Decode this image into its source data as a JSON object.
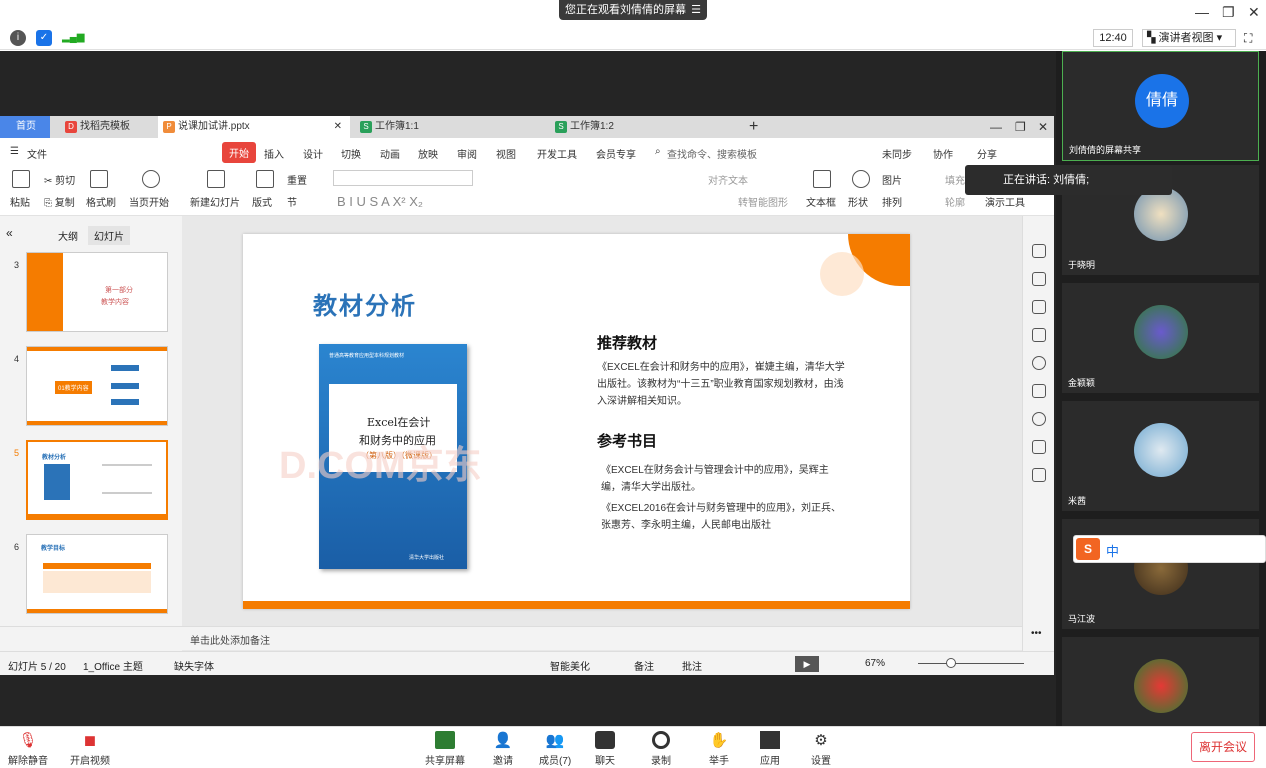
{
  "banner": {
    "text": "您正在观看刘倩倩的屏幕",
    "menu_icon": "menu-icon"
  },
  "status": {
    "time": "12:40",
    "view_label": "演讲者视图"
  },
  "wps": {
    "tabs": [
      "首页",
      "找稻壳模板",
      "说课加试讲.pptx",
      "工作簿1:1",
      "工作簿1:2"
    ],
    "menu": [
      "文件",
      "开始",
      "插入",
      "设计",
      "切换",
      "动画",
      "放映",
      "审阅",
      "视图",
      "开发工具",
      "会员专享"
    ],
    "search_placeholder": "查找命令、搜索模板",
    "right_menu": [
      "未同步",
      "协作",
      "分享"
    ],
    "ribbon": {
      "paste": "粘贴",
      "cut": "剪切",
      "copy": "复制",
      "format_painter": "格式刷",
      "start_from_current": "当页开始",
      "new_slide": "新建幻灯片",
      "layout": "版式",
      "reset": "重置",
      "section": "节",
      "align_text": "对齐文本",
      "convert_smartart": "转智能图形",
      "textbox": "文本框",
      "shape": "形状",
      "picture": "图片",
      "arrange": "排列",
      "fill": "填充",
      "outline": "轮廓",
      "presenter_tools": "演示工具"
    },
    "panel_tabs": [
      "大纲",
      "幻灯片"
    ],
    "thumbs": [
      {
        "num": "3",
        "title": "第一部分",
        "subtitle": "教学内容"
      },
      {
        "num": "4",
        "title": "01教学内容"
      },
      {
        "num": "5",
        "title": "教材分析"
      },
      {
        "num": "6",
        "title": "教学目标"
      }
    ],
    "notes_placeholder": "单击此处添加备注",
    "statusbar": {
      "slide_info": "幻灯片 5 / 20",
      "theme": "1_Office 主题",
      "missing_font": "缺失字体",
      "beautify": "智能美化",
      "notes": "备注",
      "comment": "批注",
      "zoom": "67%"
    }
  },
  "slide": {
    "title": "教材分析",
    "book_cover": {
      "series": "普通高等教育应用型本科规划教材",
      "title_line1": "Excel在会计",
      "title_line2": "和财务中的应用",
      "edition": "（第八版）（微课版）",
      "publisher": "清华大学出版社"
    },
    "watermark": "D.COM京东",
    "section1_heading": "推荐教材",
    "section1_body": "《EXCEL在会计和财务中的应用》，崔婕主编，清华大学出版社。该教材为“十三五”职业教育国家规划教材，由浅入深讲解相关知识。",
    "section2_heading": "参考书目",
    "ref1": "《EXCEL在财务会计与管理会计中的应用》，吴辉主编，清华大学出版社。",
    "ref2": "《EXCEL2016在会计与财务管理中的应用》，刘正兵、张惠芳、李永明主编，人民邮电出版社"
  },
  "speaking": "正在讲话: 刘倩倩;",
  "participants": [
    {
      "name": "刘倩倩的屏幕共享",
      "avatar_text": "倩倩"
    },
    {
      "name": "于晓明"
    },
    {
      "name": "金颖颖"
    },
    {
      "name": "米茜"
    },
    {
      "name": "马江波"
    },
    {
      "name": ""
    }
  ],
  "ime": {
    "mode": "中"
  },
  "bottom": {
    "mute": "解除静音",
    "video": "开启视频",
    "share": "共享屏幕",
    "invite": "邀请",
    "members": "成员(7)",
    "chat": "聊天",
    "record": "录制",
    "raise_hand": "举手",
    "apps": "应用",
    "settings": "设置",
    "leave": "离开会议"
  },
  "colors": {
    "accent_orange": "#f57c00",
    "wps_red": "#e8453c",
    "slide_blue": "#2b73b8",
    "leave_red": "#d33"
  }
}
